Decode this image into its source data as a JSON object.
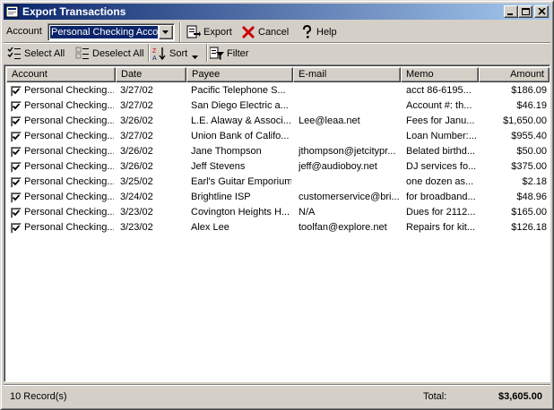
{
  "window": {
    "title": "Export Transactions",
    "buttons": [
      "minimize",
      "maximize",
      "close"
    ]
  },
  "toolbar": {
    "account_label": "Account",
    "account_value": "Personal Checking Accou",
    "export_label": "Export",
    "cancel_label": "Cancel",
    "help_label": "Help"
  },
  "selection_toolbar": {
    "select_all_label": "Select All",
    "deselect_all_label": "Deselect All",
    "sort_label": "Sort",
    "filter_label": "Filter"
  },
  "columns": {
    "account": "Account",
    "date": "Date",
    "payee": "Payee",
    "email": "E-mail",
    "memo": "Memo",
    "amount": "Amount"
  },
  "rows": [
    {
      "checked": true,
      "account": "Personal Checking...",
      "date": "3/27/02",
      "payee": "Pacific Telephone S...",
      "email": "",
      "memo": "acct 86-6195...",
      "amount": "$186.09"
    },
    {
      "checked": true,
      "account": "Personal Checking...",
      "date": "3/27/02",
      "payee": "San Diego Electric a...",
      "email": "",
      "memo": "Account #: th...",
      "amount": "$46.19"
    },
    {
      "checked": true,
      "account": "Personal Checking...",
      "date": "3/26/02",
      "payee": "L.E. Alaway & Associ...",
      "email": "Lee@leaa.net",
      "memo": "Fees for Janu...",
      "amount": "$1,650.00"
    },
    {
      "checked": true,
      "account": "Personal Checking...",
      "date": "3/27/02",
      "payee": "Union Bank of Califo...",
      "email": "",
      "memo": "Loan Number:...",
      "amount": "$955.40"
    },
    {
      "checked": true,
      "account": "Personal Checking...",
      "date": "3/26/02",
      "payee": "Jane Thompson",
      "email": "jthompson@jetcitypr...",
      "memo": "Belated birthd...",
      "amount": "$50.00"
    },
    {
      "checked": true,
      "account": "Personal Checking...",
      "date": "3/26/02",
      "payee": "Jeff Stevens",
      "email": "jeff@audioboy.net",
      "memo": "DJ services fo...",
      "amount": "$375.00"
    },
    {
      "checked": true,
      "account": "Personal Checking...",
      "date": "3/25/02",
      "payee": "Earl's Guitar Emporium",
      "email": "",
      "memo": "one dozen as...",
      "amount": "$2.18"
    },
    {
      "checked": true,
      "account": "Personal Checking...",
      "date": "3/24/02",
      "payee": "Brightline ISP",
      "email": "customerservice@bri...",
      "memo": "for broadband...",
      "amount": "$48.96"
    },
    {
      "checked": true,
      "account": "Personal Checking...",
      "date": "3/23/02",
      "payee": "Covington Heights H...",
      "email": "N/A",
      "memo": "Dues for 2112...",
      "amount": "$165.00"
    },
    {
      "checked": true,
      "account": "Personal Checking...",
      "date": "3/23/02",
      "payee": "Alex Lee",
      "email": "toolfan@explore.net",
      "memo": "Repairs for kit...",
      "amount": "$126.18"
    }
  ],
  "status": {
    "record_count": "10 Record(s)",
    "total_label": "Total:",
    "total_value": "$3,605.00"
  },
  "colors": {
    "title_bar_start": "#0a246a",
    "title_bar_end": "#a6caf0",
    "face": "#d4d0c8",
    "cancel_icon": "#cc0000"
  }
}
